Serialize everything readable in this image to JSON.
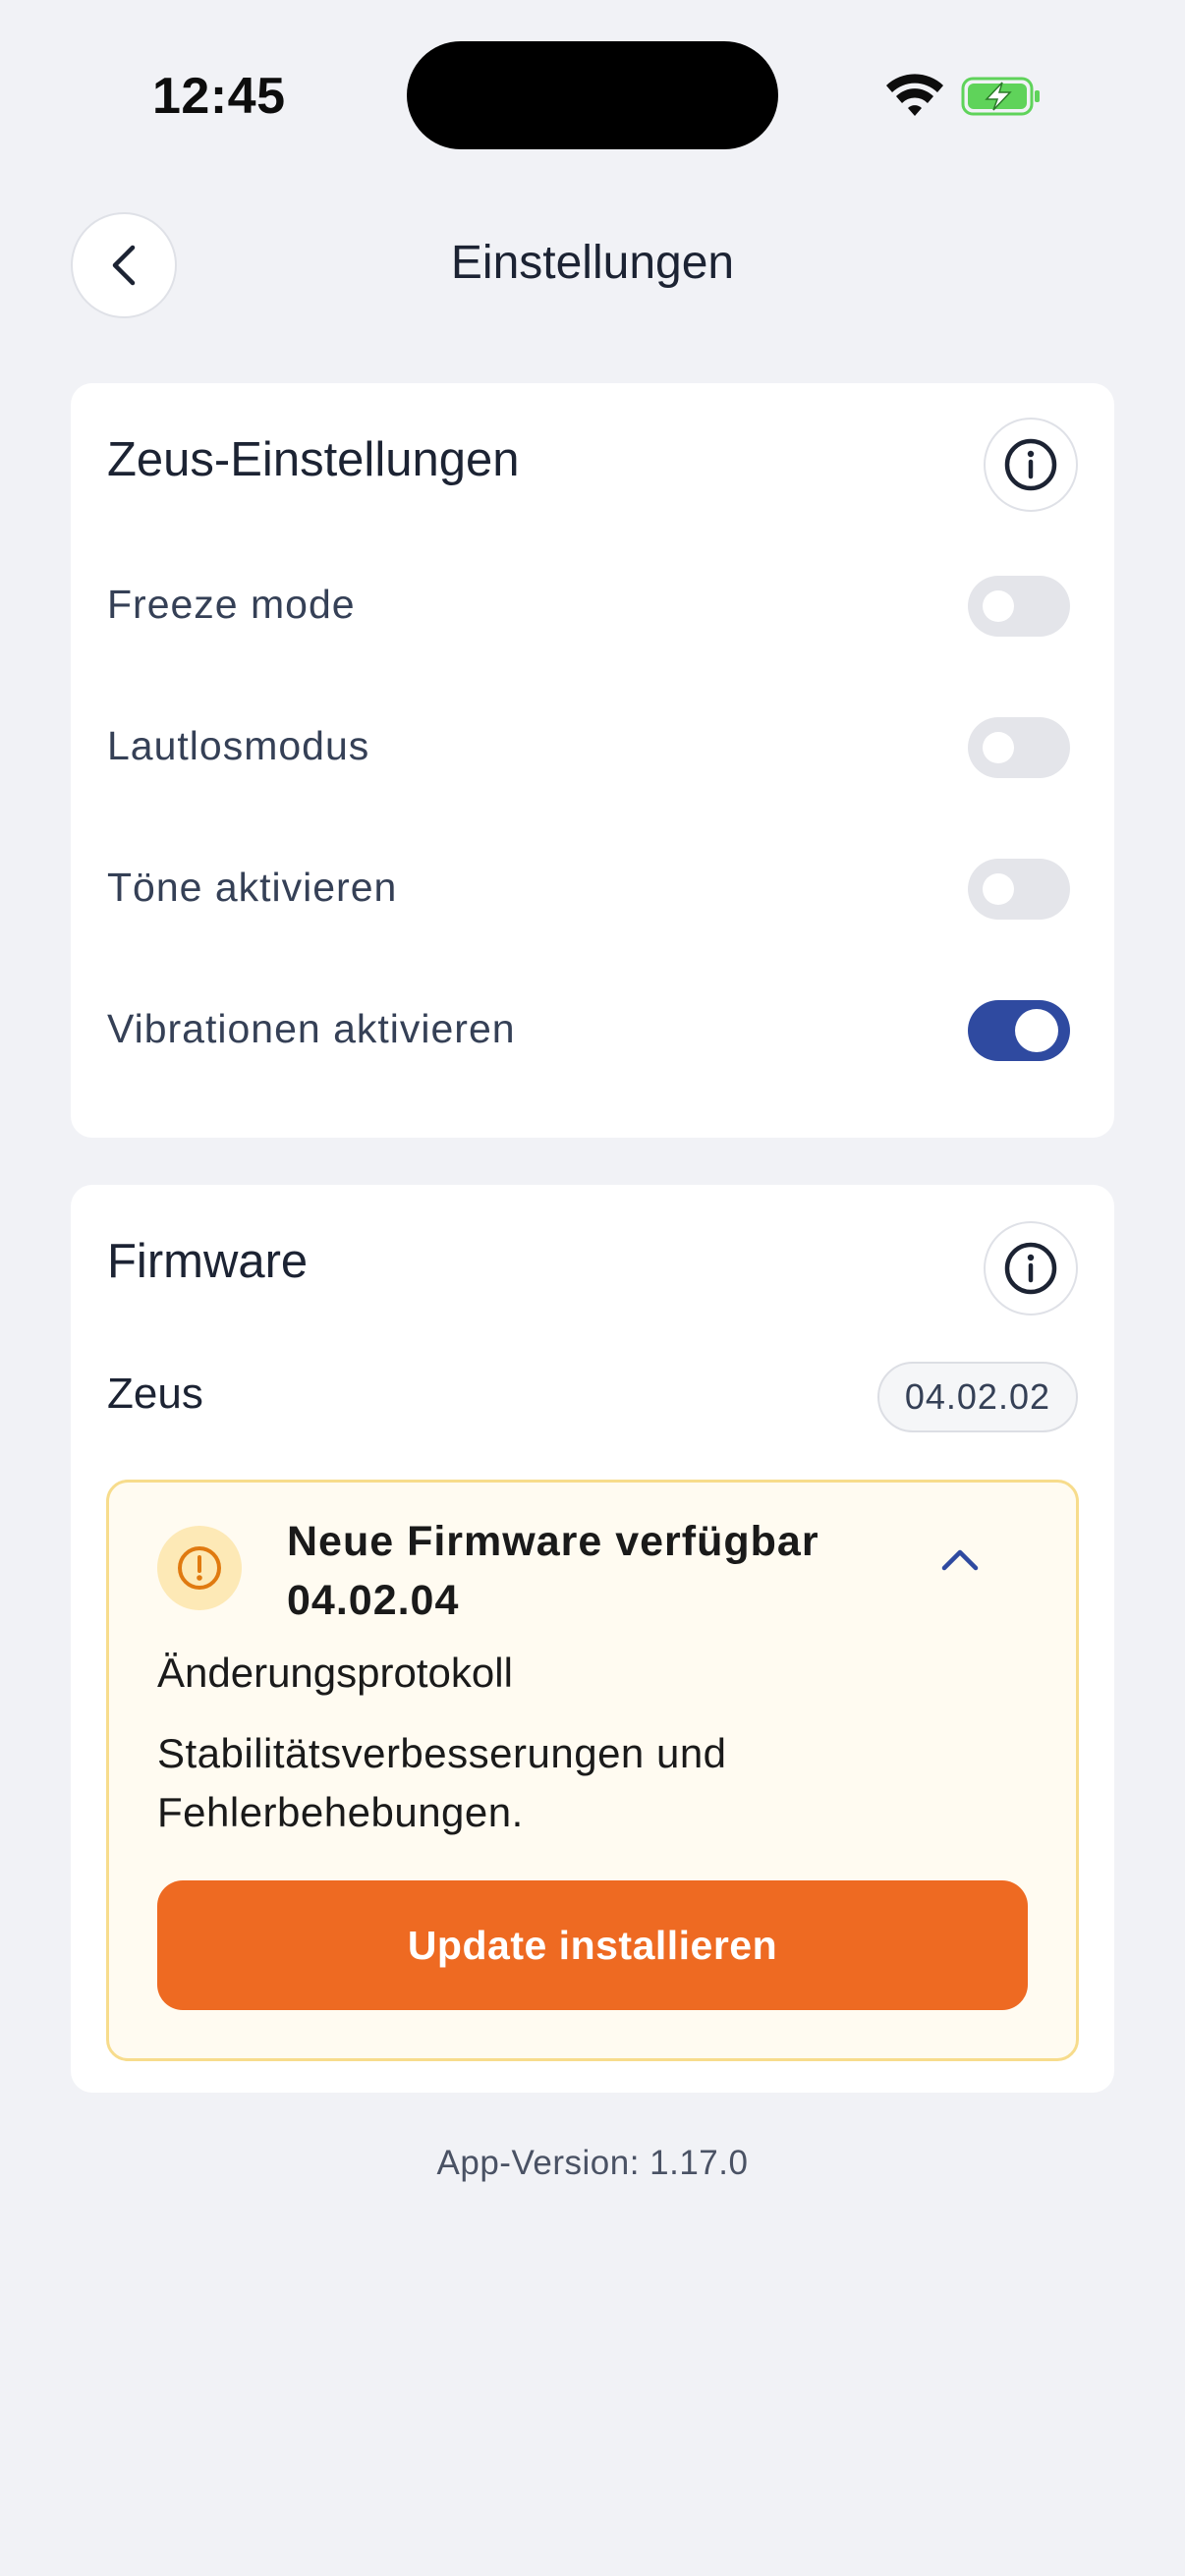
{
  "status_bar": {
    "time": "12:45"
  },
  "header": {
    "title": "Einstellungen"
  },
  "zeus_settings": {
    "title": "Zeus-Einstellungen",
    "toggles": [
      {
        "label": "Freeze mode",
        "on": false
      },
      {
        "label": "Lautlosmodus",
        "on": false
      },
      {
        "label": "Töne aktivieren",
        "on": false
      },
      {
        "label": "Vibrationen aktivieren",
        "on": true
      }
    ]
  },
  "firmware": {
    "title": "Firmware",
    "device_name": "Zeus",
    "current_version": "04.02.02",
    "update": {
      "title_line1": "Neue Firmware verfügbar",
      "title_line2": "04.02.04",
      "changelog_label": "Änderungsprotokoll",
      "changelog_text_line1": "Stabilitätsverbesserungen und",
      "changelog_text_line2": "Fehlerbehebungen.",
      "install_label": "Update installieren"
    }
  },
  "footer": {
    "app_version": "App-Version: 1.17.0"
  },
  "colors": {
    "background": "#f1f2f6",
    "accent_blue": "#2f4aa0",
    "install_orange": "#ee6a22",
    "warning_amber": "#e07a10",
    "battery_green": "#5fd35a"
  }
}
